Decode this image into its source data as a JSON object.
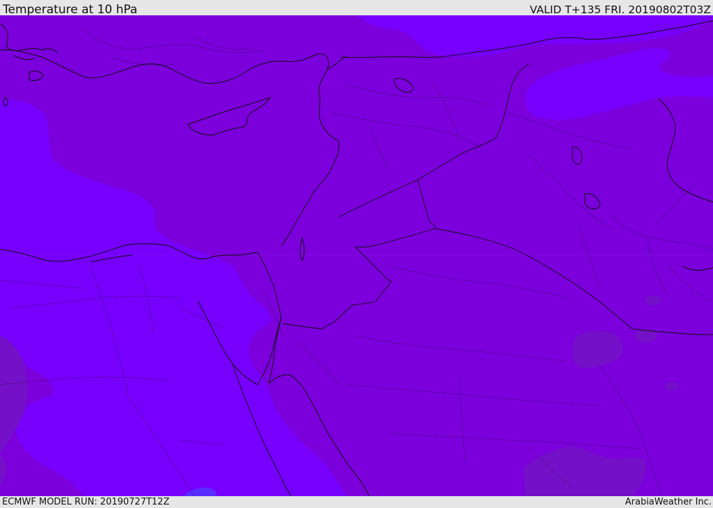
{
  "header": {
    "title": "Temperature at 10 hPa",
    "valid_time": "VALID T+135 FRI. 20190802T03Z"
  },
  "footer": {
    "model_run": "ECMWF MODEL RUN: 20190727T12Z",
    "credit": "ArabiaWeather Inc."
  },
  "colors": {
    "field_base": "#7b00dc",
    "field_light": "#7700fc",
    "field_lighter": "#7a08ff",
    "field_dark": "#7410c8",
    "field_blue": "#5a2cff",
    "coastline": "#111111",
    "border": "#111111"
  }
}
